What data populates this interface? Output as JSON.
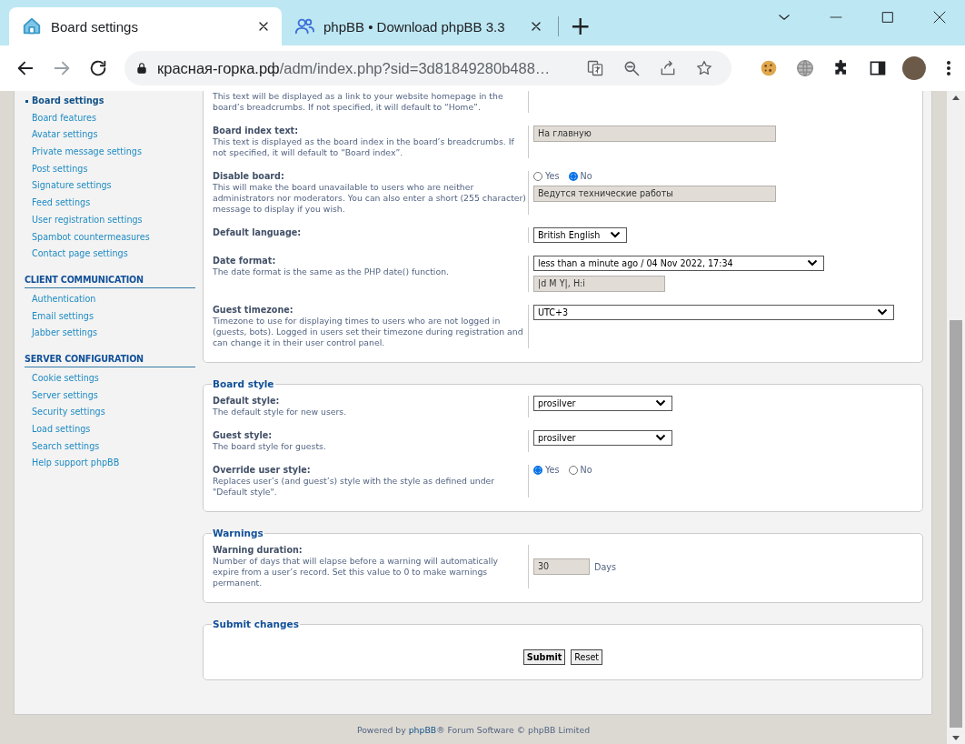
{
  "browser": {
    "tabs": [
      {
        "title": "Board settings",
        "selected": true
      },
      {
        "title": "phpBB • Download phpBB 3.3",
        "selected": false
      }
    ],
    "new_tab": "+",
    "url": {
      "host": "красная-горка.рф",
      "path": "/adm/index.php?sid=3d81849280b488…"
    }
  },
  "sidebar": {
    "sections": [
      {
        "items": [
          {
            "label": "Board settings",
            "selected": true
          },
          {
            "label": "Board features",
            "selected": false
          },
          {
            "label": "Avatar settings",
            "selected": false
          },
          {
            "label": "Private message settings",
            "selected": false
          },
          {
            "label": "Post settings",
            "selected": false
          },
          {
            "label": "Signature settings",
            "selected": false
          },
          {
            "label": "Feed settings",
            "selected": false
          },
          {
            "label": "User registration settings",
            "selected": false
          },
          {
            "label": "Spambot countermeasures",
            "selected": false
          },
          {
            "label": "Contact page settings",
            "selected": false
          }
        ]
      },
      {
        "heading": "CLIENT COMMUNICATION",
        "items": [
          {
            "label": "Authentication",
            "selected": false
          },
          {
            "label": "Email settings",
            "selected": false
          },
          {
            "label": "Jabber settings",
            "selected": false
          }
        ]
      },
      {
        "heading": "SERVER CONFIGURATION",
        "items": [
          {
            "label": "Cookie settings",
            "selected": false
          },
          {
            "label": "Server settings",
            "selected": false
          },
          {
            "label": "Security settings",
            "selected": false
          },
          {
            "label": "Load settings",
            "selected": false
          },
          {
            "label": "Search settings",
            "selected": false
          },
          {
            "label": "Help support phpBB",
            "selected": false
          }
        ]
      }
    ]
  },
  "sections": [
    {
      "kind": "settings",
      "rows": [
        {
          "kind": "note",
          "description": "This text will be displayed as a link to your website homepage in the board’s breadcrumbs. If not specified, it will default to “Home”."
        },
        {
          "kind": "text",
          "label": "Board index text:",
          "description": "This text is displayed as the board index in the board’s breadcrumbs. If not specified, it will default to “Board index”.",
          "value": "На главную"
        },
        {
          "kind": "radio_text",
          "label": "Disable board:",
          "description": "This will make the board unavailable to users who are neither administrators nor moderators. You can also enter a short (255 character) message to display if you wish.",
          "options": [
            {
              "label": "Yes",
              "selected": false
            },
            {
              "label": "No",
              "selected": true
            }
          ],
          "value": "Ведутся технические работы"
        },
        {
          "kind": "select",
          "label": "Default language:",
          "value": "British English"
        },
        {
          "kind": "select_text",
          "label": "Date format:",
          "description": "The date format is the same as the PHP date() function.",
          "value": "less than a minute ago / 04 Nov 2022, 17:34",
          "text": "|d M Y|, H:i"
        },
        {
          "kind": "select",
          "label": "Guest timezone:",
          "description": "Timezone to use for displaying times to users who are not logged in (guests, bots). Logged in users set their timezone during registration and can change it in their user control panel.",
          "value": "UTC+3"
        }
      ]
    },
    {
      "kind": "settings",
      "legend": "Board style",
      "rows": [
        {
          "kind": "select",
          "label": "Default style:",
          "description": "The default style for new users.",
          "value": "prosilver"
        },
        {
          "kind": "select",
          "label": "Guest style:",
          "description": "The board style for guests.",
          "value": "prosilver"
        },
        {
          "kind": "radio",
          "label": "Override user style:",
          "description": "Replaces user’s (and guest’s) style with the style as defined under \"Default style\".",
          "options": [
            {
              "label": "Yes",
              "selected": true
            },
            {
              "label": "No",
              "selected": false
            }
          ]
        }
      ]
    },
    {
      "kind": "settings",
      "legend": "Warnings",
      "rows": [
        {
          "kind": "number_unit",
          "label": "Warning duration:",
          "description": "Number of days that will elapse before a warning will automatically expire from a user’s record. Set this value to 0 to make warnings permanent.",
          "value": "30",
          "unit": "Days"
        }
      ]
    },
    {
      "kind": "submit",
      "legend": "Submit changes",
      "buttons": [
        {
          "label": "Submit",
          "kind": "primary"
        },
        {
          "label": "Reset",
          "kind": "secondary"
        }
      ]
    }
  ],
  "footer": {
    "prefix": "Powered by ",
    "link": "phpBB",
    "suffix": "® Forum Software © phpBB Limited"
  }
}
